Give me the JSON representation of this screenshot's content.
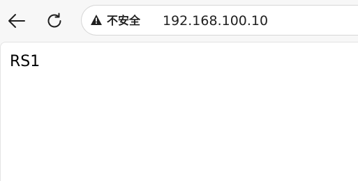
{
  "toolbar": {
    "back_icon": "arrow-left-icon",
    "reload_icon": "reload-icon"
  },
  "address_bar": {
    "security_icon": "warning-triangle-icon",
    "security_label": "不安全",
    "url": "192.168.100.10"
  },
  "page": {
    "body_text": "RS1"
  },
  "colors": {
    "chrome_background": "#f7f7f7",
    "content_background": "#ffffff",
    "icon": "#1f1f1f"
  }
}
